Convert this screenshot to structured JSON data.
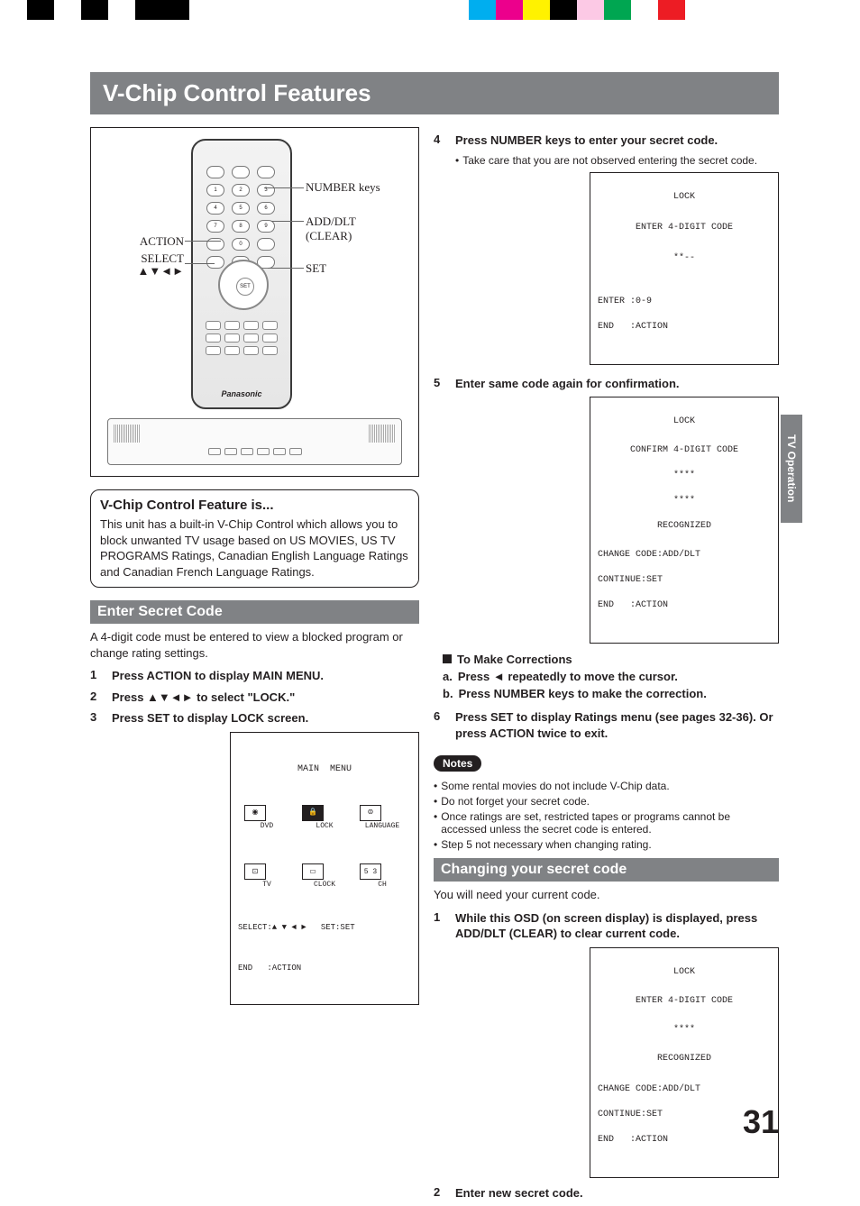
{
  "colorbar_left": [
    "#000000",
    "#ffffff",
    "#000000",
    "#ffffff",
    "#000000"
  ],
  "colorbar_right": [
    "#00aeef",
    "#ec008c",
    "#fff200",
    "#000000",
    "#00a651",
    "#ffffff",
    "#ed1c24",
    "#ffffff"
  ],
  "side_tab": "TV Operation",
  "page_number": "31",
  "title": "V-Chip Control Features",
  "callouts": {
    "action": "ACTION",
    "select_line1": "SELECT",
    "select_line2": "▲▼◄►",
    "number_keys": "NUMBER keys",
    "add_dlt": "ADD/DLT (CLEAR)",
    "set": "SET"
  },
  "remote_brand": "Panasonic",
  "info": {
    "heading": "V-Chip Control Feature is...",
    "body": "This unit has a built-in V-Chip Control which allows you to block unwanted TV usage based on US MOVIES, US TV PROGRAMS Ratings, Canadian English Language Ratings and Canadian French Language Ratings."
  },
  "section_enter": "Enter Secret Code",
  "enter_intro": "A 4-digit code must be entered to view a blocked program or change rating settings.",
  "left_steps": [
    {
      "n": "1",
      "t": "Press ACTION to display MAIN MENU."
    },
    {
      "n": "2",
      "t": "Press ▲▼◄► to select \"LOCK.\""
    },
    {
      "n": "3",
      "t": "Press SET to display LOCK screen."
    }
  ],
  "main_menu_osd": {
    "title": "MAIN  MENU",
    "items_row1": [
      "DVD",
      "LOCK",
      "LANGUAGE"
    ],
    "items_row2": [
      "TV",
      "CLOCK",
      "CH"
    ],
    "ch_val": "5 3",
    "footer1": "SELECT:▲ ▼ ◄ ►   SET:SET",
    "footer2": "END   :ACTION"
  },
  "right_steps_a": [
    {
      "n": "4",
      "t": "Press NUMBER keys to enter your secret code."
    }
  ],
  "step4_sub": "Take care that you are not observed entering the secret code.",
  "lock_osd1": {
    "title": "LOCK",
    "l1": "ENTER 4-DIGIT CODE",
    "l2": "**--",
    "f1": "ENTER :0-9",
    "f2": "END   :ACTION"
  },
  "right_steps_b": [
    {
      "n": "5",
      "t": "Enter same code again for confirmation."
    }
  ],
  "lock_osd2": {
    "title": "LOCK",
    "l1": "CONFIRM 4-DIGIT CODE",
    "l2": "****",
    "l3": "****",
    "l4": "RECOGNIZED",
    "f1": "CHANGE CODE:ADD/DLT",
    "f2": "CONTINUE:SET",
    "f3": "END   :ACTION"
  },
  "corrections": {
    "heading": "To Make Corrections",
    "a": "Press ◄ repeatedly to move the cursor.",
    "b": "Press NUMBER keys to make the correction."
  },
  "right_steps_c": [
    {
      "n": "6",
      "t": "Press SET to display Ratings menu (see pages 32-36). Or press ACTION twice to exit."
    }
  ],
  "notes_label": "Notes",
  "notes": [
    "Some rental movies do not include V-Chip data.",
    "Do not forget your secret code.",
    "Once ratings are set, restricted tapes or programs cannot be accessed unless the secret code is entered.",
    "Step 5 not necessary when changing rating."
  ],
  "section_change": "Changing your secret code",
  "change_intro": "You will need your current code.",
  "change_steps": [
    {
      "n": "1",
      "t": "While this OSD (on screen display) is displayed, press ADD/DLT (CLEAR) to clear current code."
    }
  ],
  "lock_osd3": {
    "title": "LOCK",
    "l1": "ENTER 4-DIGIT CODE",
    "l2": "****",
    "l3": "RECOGNIZED",
    "f1": "CHANGE CODE:ADD/DLT",
    "f2": "CONTINUE:SET",
    "f3": "END   :ACTION"
  },
  "change_step2": {
    "n": "2",
    "t": "Enter new secret code."
  }
}
